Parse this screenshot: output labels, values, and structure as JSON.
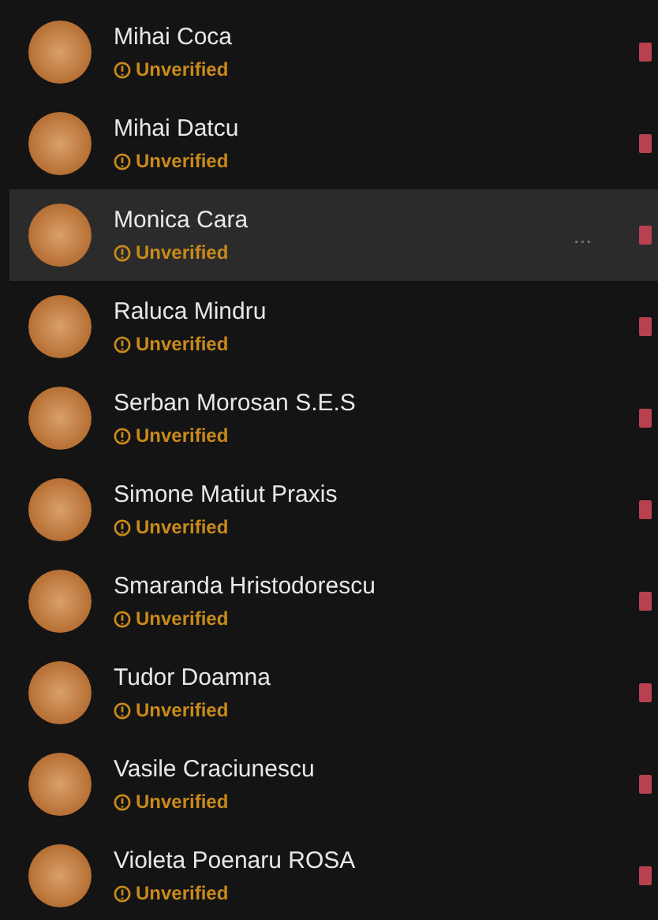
{
  "contacts": [
    {
      "name": "Mihai Coca",
      "status": "Unverified",
      "selected": false
    },
    {
      "name": "Mihai Datcu",
      "status": "Unverified",
      "selected": false
    },
    {
      "name": "Monica Cara",
      "status": "Unverified",
      "selected": true,
      "more": "..."
    },
    {
      "name": "Raluca Mindru",
      "status": "Unverified",
      "selected": false
    },
    {
      "name": "Serban Morosan S.E.S",
      "status": "Unverified",
      "selected": false
    },
    {
      "name": "Simone Matiut Praxis",
      "status": "Unverified",
      "selected": false
    },
    {
      "name": "Smaranda Hristodorescu",
      "status": "Unverified",
      "selected": false
    },
    {
      "name": "Tudor Doamna",
      "status": "Unverified",
      "selected": false
    },
    {
      "name": "Vasile Craciunescu",
      "status": "Unverified",
      "selected": false
    },
    {
      "name": "Violeta Poenaru ROSA",
      "status": "Unverified",
      "selected": false
    }
  ]
}
